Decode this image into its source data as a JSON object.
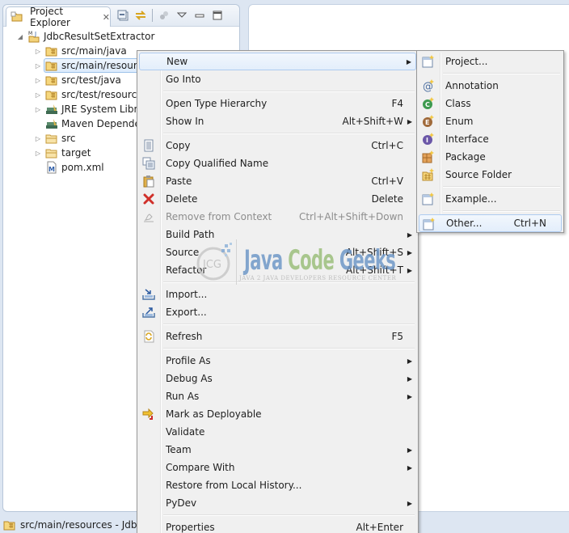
{
  "explorer": {
    "tab_label": "Project Explorer",
    "tab_close": "✕",
    "tools": [
      "collapse-all-icon",
      "link-with-editor-icon",
      "focus-icon",
      "view-menu-icon",
      "minimize-icon",
      "maximize-icon"
    ],
    "tree": [
      {
        "label": "JdbcResultSetExtractor",
        "icon": "maven-project-icon",
        "level": 0,
        "expanded": true
      },
      {
        "label": "src/main/java",
        "icon": "source-folder-icon",
        "level": 1,
        "expandable": true
      },
      {
        "label": "src/main/resources",
        "icon": "source-folder-icon",
        "level": 1,
        "expandable": true,
        "selected": true
      },
      {
        "label": "src/test/java",
        "icon": "source-folder-icon",
        "level": 1,
        "expandable": true
      },
      {
        "label": "src/test/resources",
        "icon": "source-folder-icon",
        "level": 1,
        "expandable": true
      },
      {
        "label": "JRE System Library",
        "icon": "library-icon",
        "level": 1,
        "expandable": true
      },
      {
        "label": "Maven Dependencies",
        "icon": "library-icon",
        "level": 1,
        "expandable": false
      },
      {
        "label": "src",
        "icon": "folder-icon",
        "level": 1,
        "expandable": true
      },
      {
        "label": "target",
        "icon": "folder-icon",
        "level": 1,
        "expandable": true
      },
      {
        "label": "pom.xml",
        "icon": "maven-file-icon",
        "level": 1,
        "expandable": false
      }
    ]
  },
  "statusbar": {
    "text": "src/main/resources - JdbcResultSetExtractor"
  },
  "context_menu": {
    "items": [
      {
        "label": "New",
        "submenu": true,
        "hover": true
      },
      {
        "label": "Go Into"
      },
      {
        "sep": true
      },
      {
        "label": "Open Type Hierarchy",
        "accel": "F4"
      },
      {
        "label": "Show In",
        "accel": "Alt+Shift+W",
        "submenu": true
      },
      {
        "sep": true
      },
      {
        "label": "Copy",
        "accel": "Ctrl+C",
        "icon": "copy-icon"
      },
      {
        "label": "Copy Qualified Name",
        "icon": "copy-qualified-name-icon"
      },
      {
        "label": "Paste",
        "accel": "Ctrl+V",
        "icon": "paste-icon"
      },
      {
        "label": "Delete",
        "accel": "Delete",
        "icon": "delete-icon"
      },
      {
        "label": "Remove from Context",
        "accel": "Ctrl+Alt+Shift+Down",
        "icon": "remove-context-icon",
        "disabled": true
      },
      {
        "label": "Build Path",
        "submenu": true
      },
      {
        "label": "Source",
        "accel": "Alt+Shift+S",
        "submenu": true
      },
      {
        "label": "Refactor",
        "accel": "Alt+Shift+T",
        "submenu": true
      },
      {
        "sep": true
      },
      {
        "label": "Import...",
        "icon": "import-icon"
      },
      {
        "label": "Export...",
        "icon": "export-icon"
      },
      {
        "sep": true
      },
      {
        "label": "Refresh",
        "accel": "F5",
        "icon": "refresh-icon"
      },
      {
        "sep": true
      },
      {
        "label": "Profile As",
        "submenu": true
      },
      {
        "label": "Debug As",
        "submenu": true
      },
      {
        "label": "Run As",
        "submenu": true
      },
      {
        "label": "Mark as Deployable",
        "icon": "deploy-icon"
      },
      {
        "label": "Validate"
      },
      {
        "label": "Team",
        "submenu": true
      },
      {
        "label": "Compare With",
        "submenu": true
      },
      {
        "label": "Restore from Local History..."
      },
      {
        "label": "PyDev",
        "submenu": true
      },
      {
        "sep": true
      },
      {
        "label": "Properties",
        "accel": "Alt+Enter"
      }
    ]
  },
  "new_submenu": {
    "items": [
      {
        "label": "Project...",
        "icon": "new-project-icon"
      },
      {
        "sep": true
      },
      {
        "label": "Annotation",
        "icon": "new-annotation-icon"
      },
      {
        "label": "Class",
        "icon": "new-class-icon"
      },
      {
        "label": "Enum",
        "icon": "new-enum-icon"
      },
      {
        "label": "Interface",
        "icon": "new-interface-icon"
      },
      {
        "label": "Package",
        "icon": "new-package-icon"
      },
      {
        "label": "Source Folder",
        "icon": "new-source-folder-icon"
      },
      {
        "sep": true
      },
      {
        "label": "Example...",
        "icon": "new-example-icon"
      },
      {
        "sep": true
      },
      {
        "label": "Other...",
        "accel": "Ctrl+N",
        "icon": "new-other-icon",
        "hover": true
      }
    ]
  },
  "watermark": {
    "logo_text": "JCG",
    "title_1": "Java",
    "title_2": "Code",
    "title_3": "Geeks",
    "subtitle": "JAVA 2 JAVA DEVELOPERS RESOURCE CENTER"
  }
}
